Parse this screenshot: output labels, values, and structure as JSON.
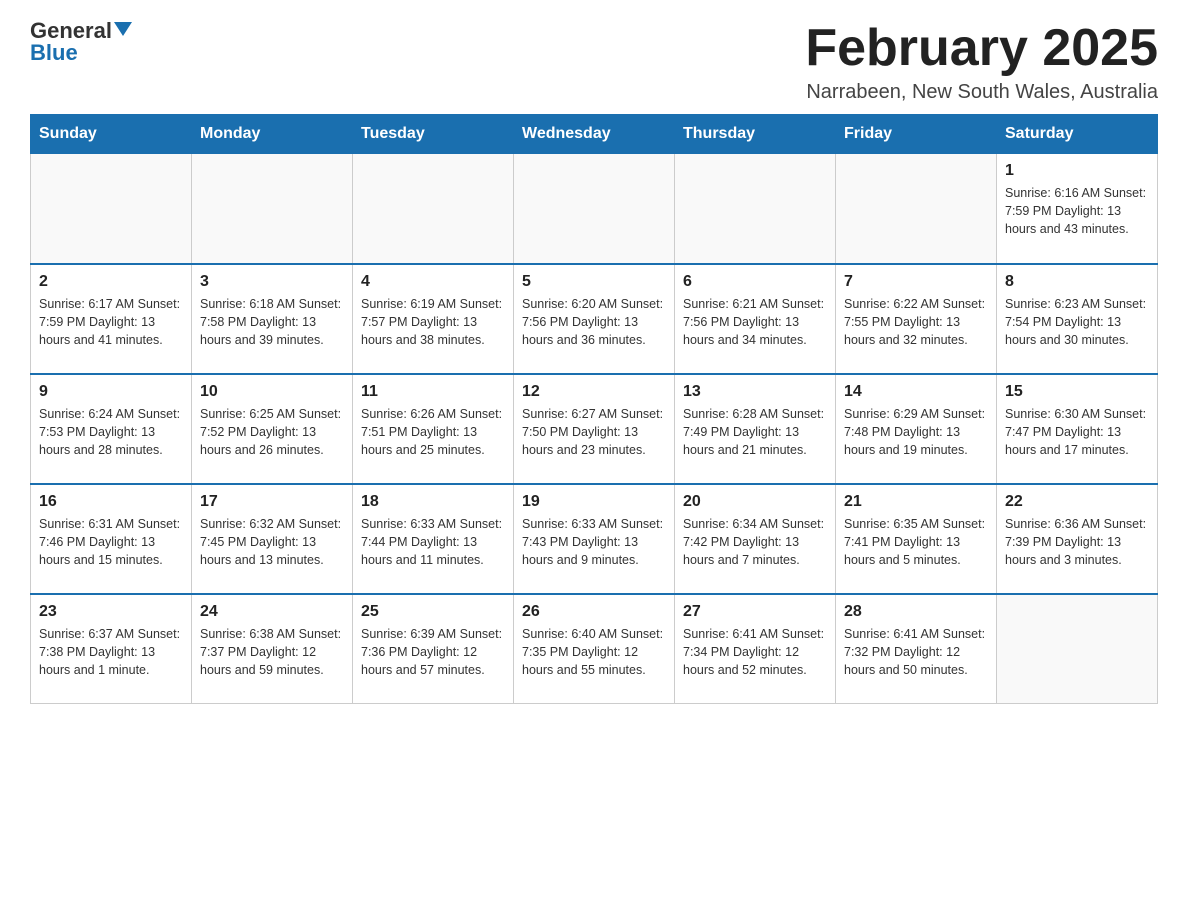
{
  "header": {
    "logo_general": "General",
    "logo_blue": "Blue",
    "title": "February 2025",
    "subtitle": "Narrabeen, New South Wales, Australia"
  },
  "weekdays": [
    "Sunday",
    "Monday",
    "Tuesday",
    "Wednesday",
    "Thursday",
    "Friday",
    "Saturday"
  ],
  "weeks": [
    [
      {
        "day": "",
        "info": ""
      },
      {
        "day": "",
        "info": ""
      },
      {
        "day": "",
        "info": ""
      },
      {
        "day": "",
        "info": ""
      },
      {
        "day": "",
        "info": ""
      },
      {
        "day": "",
        "info": ""
      },
      {
        "day": "1",
        "info": "Sunrise: 6:16 AM\nSunset: 7:59 PM\nDaylight: 13 hours and 43 minutes."
      }
    ],
    [
      {
        "day": "2",
        "info": "Sunrise: 6:17 AM\nSunset: 7:59 PM\nDaylight: 13 hours and 41 minutes."
      },
      {
        "day": "3",
        "info": "Sunrise: 6:18 AM\nSunset: 7:58 PM\nDaylight: 13 hours and 39 minutes."
      },
      {
        "day": "4",
        "info": "Sunrise: 6:19 AM\nSunset: 7:57 PM\nDaylight: 13 hours and 38 minutes."
      },
      {
        "day": "5",
        "info": "Sunrise: 6:20 AM\nSunset: 7:56 PM\nDaylight: 13 hours and 36 minutes."
      },
      {
        "day": "6",
        "info": "Sunrise: 6:21 AM\nSunset: 7:56 PM\nDaylight: 13 hours and 34 minutes."
      },
      {
        "day": "7",
        "info": "Sunrise: 6:22 AM\nSunset: 7:55 PM\nDaylight: 13 hours and 32 minutes."
      },
      {
        "day": "8",
        "info": "Sunrise: 6:23 AM\nSunset: 7:54 PM\nDaylight: 13 hours and 30 minutes."
      }
    ],
    [
      {
        "day": "9",
        "info": "Sunrise: 6:24 AM\nSunset: 7:53 PM\nDaylight: 13 hours and 28 minutes."
      },
      {
        "day": "10",
        "info": "Sunrise: 6:25 AM\nSunset: 7:52 PM\nDaylight: 13 hours and 26 minutes."
      },
      {
        "day": "11",
        "info": "Sunrise: 6:26 AM\nSunset: 7:51 PM\nDaylight: 13 hours and 25 minutes."
      },
      {
        "day": "12",
        "info": "Sunrise: 6:27 AM\nSunset: 7:50 PM\nDaylight: 13 hours and 23 minutes."
      },
      {
        "day": "13",
        "info": "Sunrise: 6:28 AM\nSunset: 7:49 PM\nDaylight: 13 hours and 21 minutes."
      },
      {
        "day": "14",
        "info": "Sunrise: 6:29 AM\nSunset: 7:48 PM\nDaylight: 13 hours and 19 minutes."
      },
      {
        "day": "15",
        "info": "Sunrise: 6:30 AM\nSunset: 7:47 PM\nDaylight: 13 hours and 17 minutes."
      }
    ],
    [
      {
        "day": "16",
        "info": "Sunrise: 6:31 AM\nSunset: 7:46 PM\nDaylight: 13 hours and 15 minutes."
      },
      {
        "day": "17",
        "info": "Sunrise: 6:32 AM\nSunset: 7:45 PM\nDaylight: 13 hours and 13 minutes."
      },
      {
        "day": "18",
        "info": "Sunrise: 6:33 AM\nSunset: 7:44 PM\nDaylight: 13 hours and 11 minutes."
      },
      {
        "day": "19",
        "info": "Sunrise: 6:33 AM\nSunset: 7:43 PM\nDaylight: 13 hours and 9 minutes."
      },
      {
        "day": "20",
        "info": "Sunrise: 6:34 AM\nSunset: 7:42 PM\nDaylight: 13 hours and 7 minutes."
      },
      {
        "day": "21",
        "info": "Sunrise: 6:35 AM\nSunset: 7:41 PM\nDaylight: 13 hours and 5 minutes."
      },
      {
        "day": "22",
        "info": "Sunrise: 6:36 AM\nSunset: 7:39 PM\nDaylight: 13 hours and 3 minutes."
      }
    ],
    [
      {
        "day": "23",
        "info": "Sunrise: 6:37 AM\nSunset: 7:38 PM\nDaylight: 13 hours and 1 minute."
      },
      {
        "day": "24",
        "info": "Sunrise: 6:38 AM\nSunset: 7:37 PM\nDaylight: 12 hours and 59 minutes."
      },
      {
        "day": "25",
        "info": "Sunrise: 6:39 AM\nSunset: 7:36 PM\nDaylight: 12 hours and 57 minutes."
      },
      {
        "day": "26",
        "info": "Sunrise: 6:40 AM\nSunset: 7:35 PM\nDaylight: 12 hours and 55 minutes."
      },
      {
        "day": "27",
        "info": "Sunrise: 6:41 AM\nSunset: 7:34 PM\nDaylight: 12 hours and 52 minutes."
      },
      {
        "day": "28",
        "info": "Sunrise: 6:41 AM\nSunset: 7:32 PM\nDaylight: 12 hours and 50 minutes."
      },
      {
        "day": "",
        "info": ""
      }
    ]
  ]
}
